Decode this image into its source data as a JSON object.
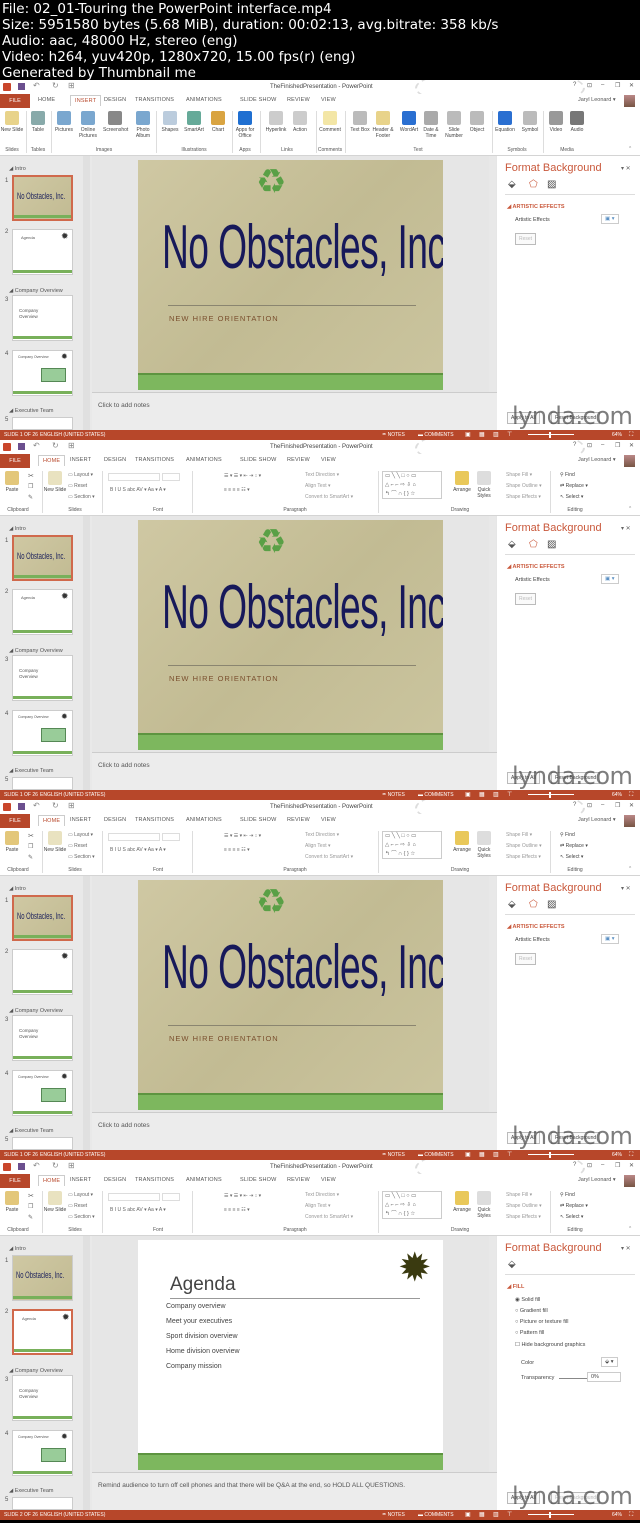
{
  "header": {
    "lines": [
      "File: 02_01-Touring the PowerPoint interface.mp4",
      "Size: 5951580 bytes (5.68 MiB), duration: 00:02:13, avg.bitrate: 358 kb/s",
      "Audio: aac, 48000 Hz, stereo (eng)",
      "Video: h264, yuv420p, 1280x720, 15.00 fps(r) (eng)",
      "Generated by Thumbnail me"
    ]
  },
  "app": {
    "window_title": "TheFinishedPresentation - PowerPoint",
    "user": "Jaryl Leonard",
    "window_controls": [
      "?",
      "⊡",
      "–",
      "❐",
      "✕"
    ],
    "tabs": [
      "FILE",
      "HOME",
      "INSERT",
      "DESIGN",
      "TRANSITIONS",
      "ANIMATIONS",
      "SLIDE SHOW",
      "REVIEW",
      "VIEW"
    ],
    "watermark": "lynda.com",
    "accent_color": "#b7472a"
  },
  "ribbons": {
    "INSERT": {
      "buttons": [
        "New Slide",
        "Table",
        "Pictures",
        "Online Pictures",
        "Screenshot",
        "Photo Album",
        "Shapes",
        "SmartArt",
        "Chart",
        "Apps for Office",
        "Hyperlink",
        "Action",
        "Comment",
        "Text Box",
        "Header & Footer",
        "WordArt",
        "Date & Time",
        "Slide Number",
        "Object",
        "Equation",
        "Symbol",
        "Video",
        "Audio"
      ],
      "groups": [
        "Slides",
        "Tables",
        "Images",
        "Illustrations",
        "Apps",
        "Links",
        "Comments",
        "Text",
        "Symbols",
        "Media"
      ]
    },
    "HOME": {
      "buttons": [
        "Paste",
        "New Slide",
        "Layout",
        "Reset",
        "Section",
        "Text Direction",
        "Align Text",
        "Convert to SmartArt",
        "Arrange",
        "Quick Styles",
        "Shape Fill",
        "Shape Outline",
        "Shape Effects",
        "Find",
        "Replace",
        "Select"
      ],
      "groups": [
        "Clipboard",
        "Slides",
        "Font",
        "Paragraph",
        "Drawing",
        "Editing"
      ]
    }
  },
  "thumbnails": {
    "sections": [
      "Intro",
      "Company Overview",
      "Executive Team"
    ],
    "numbers": [
      "1",
      "2",
      "3",
      "4",
      "5"
    ],
    "slide3_text": "Company Overview",
    "slide2_text": "Agenda",
    "slide4_text": "Company Overview"
  },
  "slide1": {
    "title": "No Obstacles, Inc.",
    "subtitle": "NEW HIRE ORIENTATION"
  },
  "slide2": {
    "title": "Agenda",
    "bullets": [
      "Company overview",
      "Meet your executives",
      "Sport division overview",
      "Home division overview",
      "Company mission"
    ]
  },
  "format_pane": {
    "title": "Format Background",
    "artistic": {
      "section": "ARTISTIC EFFECTS",
      "label": "Artistic Effects",
      "reset": "Reset"
    },
    "fill": {
      "section": "FILL",
      "options": [
        "Solid fill",
        "Gradient fill",
        "Picture or texture fill",
        "Pattern fill"
      ],
      "selected": "Solid fill",
      "hide_label": "Hide background graphics",
      "color_label": "Color",
      "transparency_label": "Transparency",
      "transparency_value": "0%"
    },
    "apply_all": "Apply to All",
    "reset_background": "Reset Background"
  },
  "status": {
    "language": "ENGLISH (UNITED STATES)",
    "notes": "NOTES",
    "comments": "COMMENTS",
    "zoom": "64%"
  },
  "frames": [
    {
      "active_tab": "INSERT",
      "slide": 1,
      "status_slide": "SLIDE 1 OF 26",
      "notes": "Click to add notes",
      "pane": "artistic"
    },
    {
      "active_tab": "HOME",
      "slide": 1,
      "status_slide": "SLIDE 1 OF 26",
      "notes": "Click to add notes",
      "pane": "artistic"
    },
    {
      "active_tab": "HOME",
      "slide": 1,
      "status_slide": "SLIDE 1 OF 26",
      "notes": "Click to add notes",
      "pane": "artistic"
    },
    {
      "active_tab": "HOME",
      "slide": 2,
      "status_slide": "SLIDE 2 OF 26",
      "notes": "Remind audience to turn off cell phones and that there will be Q&A at the end, so HOLD ALL QUESTIONS.",
      "pane": "fill"
    }
  ]
}
